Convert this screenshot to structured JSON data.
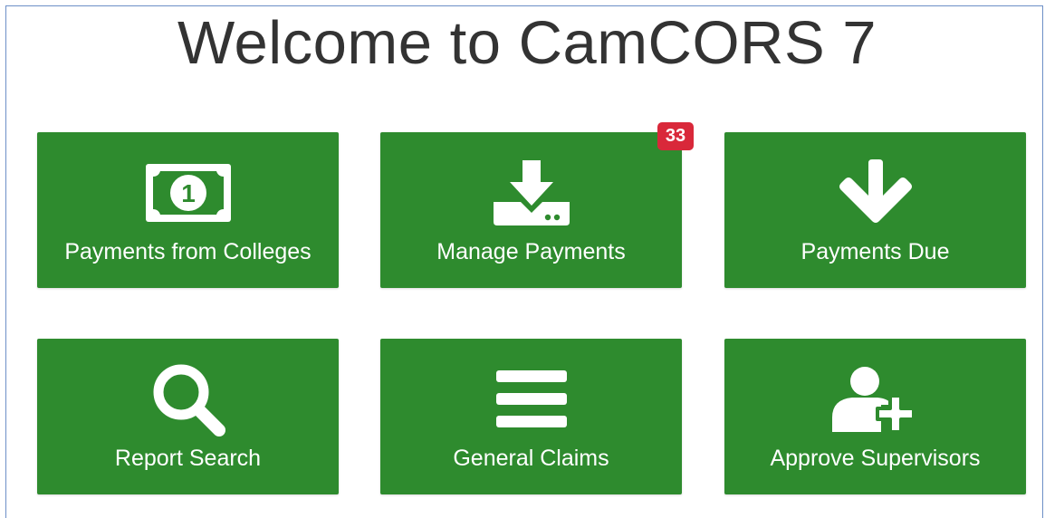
{
  "page": {
    "title": "Welcome to CamCORS 7"
  },
  "tiles": [
    {
      "label": "Payments from Colleges",
      "icon": "money-icon"
    },
    {
      "label": "Manage Payments",
      "icon": "download-drive-icon",
      "badge": "33"
    },
    {
      "label": "Payments Due",
      "icon": "arrow-down-icon"
    },
    {
      "label": "Report Search",
      "icon": "search-icon"
    },
    {
      "label": "General Claims",
      "icon": "menu-lines-icon"
    },
    {
      "label": "Approve Supervisors",
      "icon": "add-user-icon"
    }
  ],
  "colors": {
    "tile_green": "#2e8b2e",
    "badge_red": "#d9283a",
    "icon_white": "#ffffff"
  }
}
